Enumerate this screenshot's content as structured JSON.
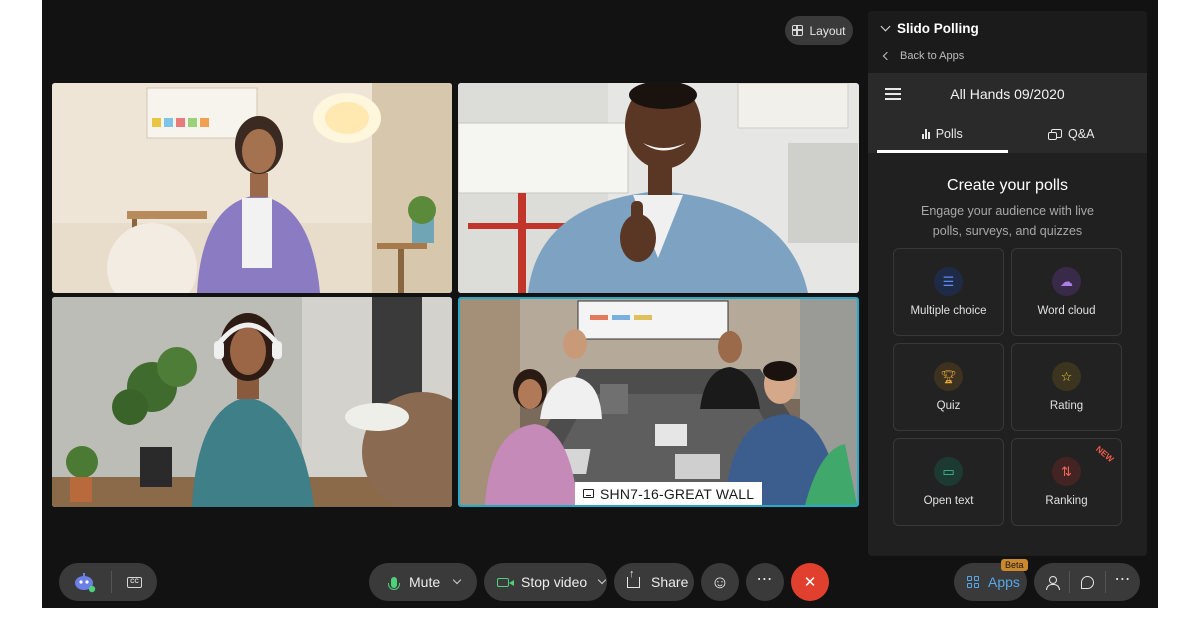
{
  "layout_button": {
    "label": "Layout",
    "icon": "grid-layout-icon"
  },
  "participants": [
    {
      "name": "",
      "background": "home-office"
    },
    {
      "name": "",
      "background": "studio"
    },
    {
      "name": "",
      "background": "living-room"
    },
    {
      "name": "SHN7-16-GREAT WALL",
      "background": "conference-room",
      "active_speaker": true
    }
  ],
  "side_panel": {
    "title": "Slido Polling",
    "back_link": "Back to Apps",
    "slido": {
      "event_title": "All Hands 09/2020",
      "tabs": [
        {
          "label": "Polls",
          "icon": "bar-chart-icon",
          "active": true
        },
        {
          "label": "Q&A",
          "icon": "chat-bubbles-icon",
          "active": false
        }
      ],
      "heading": "Create your polls",
      "description_line1": "Engage your audience with live",
      "description_line2": "polls, surveys, and quizzes",
      "poll_types": [
        {
          "label": "Multiple choice",
          "icon": "list-icon",
          "color": "#5b8cf0",
          "bg": "#1f2a46"
        },
        {
          "label": "Word cloud",
          "icon": "cloud-icon",
          "color": "#b07ee6",
          "bg": "#3a2a4a"
        },
        {
          "label": "Quiz",
          "icon": "trophy-icon",
          "color": "#e9a93a",
          "bg": "#3d3120"
        },
        {
          "label": "Rating",
          "icon": "star-icon",
          "color": "#f0c93c",
          "bg": "#3b3520"
        },
        {
          "label": "Open text",
          "icon": "speech-bubble-icon",
          "color": "#3ec99a",
          "bg": "#1d3a32"
        },
        {
          "label": "Ranking",
          "icon": "sort-arrows-icon",
          "color": "#ee6a5a",
          "bg": "#432422",
          "badge": "NEW"
        }
      ]
    }
  },
  "toolbar": {
    "mute_label": "Mute",
    "stop_video_label": "Stop video",
    "share_label": "Share",
    "apps_label": "Apps",
    "apps_badge": "Beta",
    "cc_label": "CC",
    "more_label": "⋯",
    "end_call_symbol": "✕",
    "reaction_symbol": "☺"
  },
  "colors": {
    "accent_green": "#4fd07a",
    "end_call_red": "#e2402f",
    "active_speaker_border": "#27a9c9",
    "apps_blue": "#56a8ea"
  }
}
